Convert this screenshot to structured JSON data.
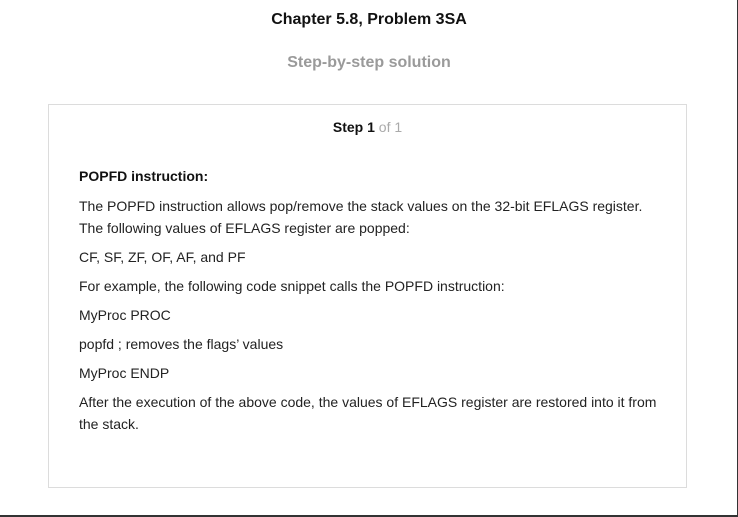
{
  "header": {
    "title": "Chapter 5.8, Problem 3SA",
    "subtitle": "Step-by-step solution"
  },
  "step": {
    "label": "Step",
    "number": "1",
    "of_text": "of 1"
  },
  "solution": {
    "heading": "POPFD instruction:",
    "paragraphs": [
      "The POPFD instruction allows pop/remove the stack values on the 32-bit EFLAGS register. The following values of EFLAGS register are popped:",
      "CF, SF, ZF, OF, AF, and PF",
      "For example, the following code snippet calls the POPFD instruction:",
      "MyProc PROC",
      "popfd ; removes the flags’ values",
      "MyProc ENDP",
      "After the execution of the above code, the values of EFLAGS register are restored into it from the stack."
    ]
  }
}
